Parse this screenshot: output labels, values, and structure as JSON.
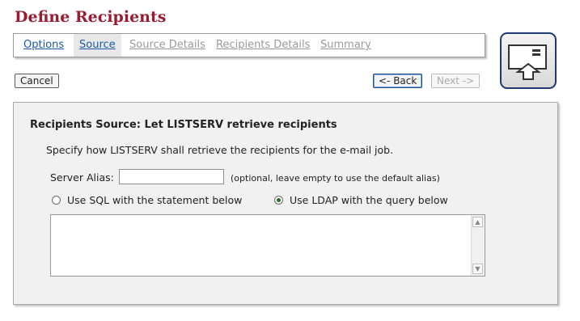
{
  "page": {
    "title": "Define Recipients"
  },
  "tabs": [
    {
      "label": "Options",
      "state": "enabled"
    },
    {
      "label": "Source",
      "state": "active"
    },
    {
      "label": "Source Details",
      "state": "disabled"
    },
    {
      "label": "Recipients Details",
      "state": "disabled"
    },
    {
      "label": "Summary",
      "state": "disabled"
    }
  ],
  "buttons": {
    "cancel": "Cancel",
    "back": "<- Back",
    "next": "Next ->"
  },
  "panel": {
    "heading": "Recipients Source: Let LISTSERV retrieve recipients",
    "description": "Specify how LISTSERV shall retrieve the recipients for the e-mail job.",
    "server_alias": {
      "label": "Server Alias:",
      "value": "",
      "hint": "(optional, leave empty to use the default alias)"
    },
    "options": [
      {
        "label": "Use SQL with the statement below",
        "checked": false
      },
      {
        "label": "Use LDAP with the query below",
        "checked": true
      }
    ],
    "query_text": ""
  },
  "icons": {
    "wizard": "mail-envelope-icon",
    "scroll_up": "scroll-up-arrow-icon",
    "scroll_down": "scroll-down-arrow-icon"
  },
  "colors": {
    "title": "#9b1b30",
    "link": "#1a5aa6",
    "disabled": "#9a9a9a",
    "icon_border": "#1f3a73"
  }
}
